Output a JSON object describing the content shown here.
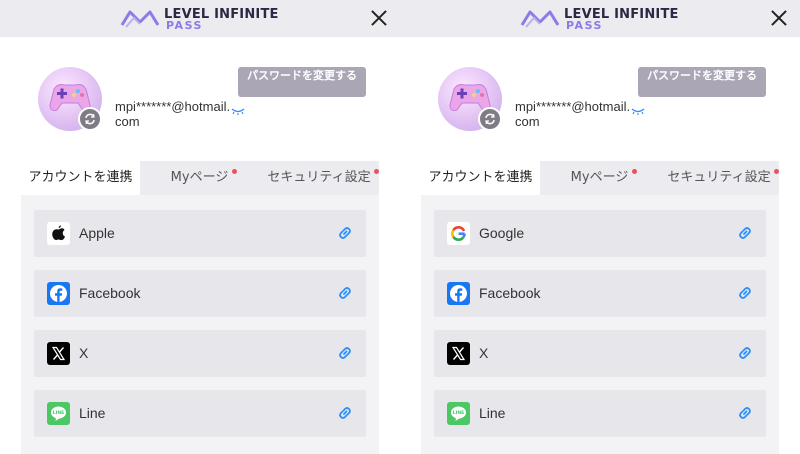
{
  "colors": {
    "accent": "#8b7be6",
    "link": "#2f8ff5",
    "button": "#aaa6b5",
    "badge": "#e8535a"
  },
  "panels": [
    {
      "brand": {
        "line1": "LEVEL INFINITE",
        "line2": "PASS"
      },
      "change_password": "パスワードを変更する",
      "email": "mpi*******@hotmail.com",
      "tabs": [
        {
          "label": "アカウントを連携",
          "active": true,
          "badge": false
        },
        {
          "label": "Myページ",
          "active": false,
          "badge": true
        },
        {
          "label": "セキュリティ設定",
          "active": false,
          "badge": true
        }
      ],
      "accounts": [
        {
          "name": "Apple",
          "icon": "apple-icon"
        },
        {
          "name": "Facebook",
          "icon": "facebook-icon"
        },
        {
          "name": "X",
          "icon": "x-icon"
        },
        {
          "name": "Line",
          "icon": "line-icon"
        }
      ]
    },
    {
      "brand": {
        "line1": "LEVEL INFINITE",
        "line2": "PASS"
      },
      "change_password": "パスワードを変更する",
      "email": "mpi*******@hotmail.com",
      "tabs": [
        {
          "label": "アカウントを連携",
          "active": true,
          "badge": false
        },
        {
          "label": "Myページ",
          "active": false,
          "badge": true
        },
        {
          "label": "セキュリティ設定",
          "active": false,
          "badge": true
        }
      ],
      "accounts": [
        {
          "name": "Google",
          "icon": "google-icon"
        },
        {
          "name": "Facebook",
          "icon": "facebook-icon"
        },
        {
          "name": "X",
          "icon": "x-icon"
        },
        {
          "name": "Line",
          "icon": "line-icon"
        }
      ]
    }
  ]
}
